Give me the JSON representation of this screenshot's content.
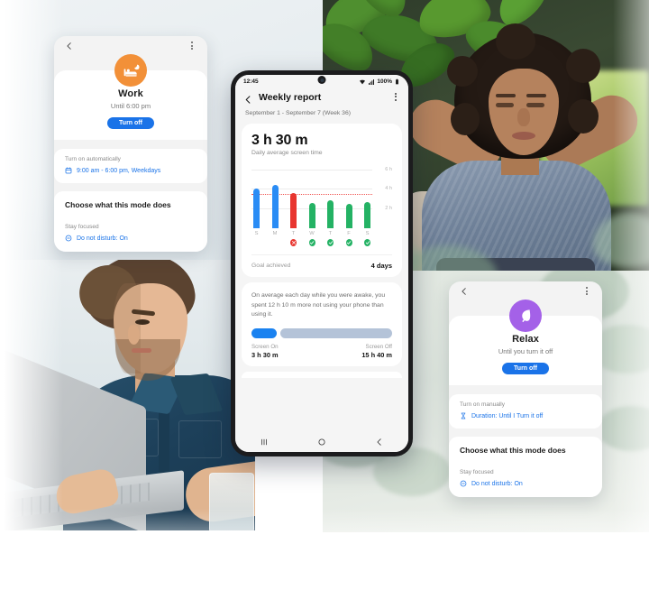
{
  "scene": {
    "photos": [
      {
        "name": "man-working-laptop",
        "alt": "Man in denim shirt working on a laptop at a desk"
      },
      {
        "name": "woman-relaxing",
        "alt": "Woman relaxing in a chair with hands behind head"
      },
      {
        "name": "eucalyptus-leaves",
        "alt": "Soft blurred eucalyptus leaves"
      }
    ]
  },
  "work_card": {
    "back_icon": "chevron-left-icon",
    "more_icon": "more-vertical-icon",
    "mode_icon": "bed-moon-icon",
    "icon_color": "#f29038",
    "title": "Work",
    "subtitle": "Until 6:00 pm",
    "button_label": "Turn off",
    "schedule_label": "Turn on automatically",
    "schedule_icon": "calendar-icon",
    "schedule_value": "9:00 am - 6:00 pm, Weekdays",
    "choose_label": "Choose what this mode does",
    "focus_label": "Stay focused",
    "focus_icon": "do-not-disturb-icon",
    "focus_value": "Do not disturb: On"
  },
  "relax_card": {
    "back_icon": "chevron-left-icon",
    "more_icon": "more-vertical-icon",
    "mode_icon": "leaf-icon",
    "icon_color": "#a461e8",
    "title": "Relax",
    "subtitle": "Until you turn it off",
    "button_label": "Turn off",
    "schedule_label": "Turn on manually",
    "schedule_icon": "hourglass-icon",
    "schedule_value": "Duration: Until I Turn it off",
    "choose_label": "Choose what this mode does",
    "focus_label": "Stay focused",
    "focus_icon": "do-not-disturb-icon",
    "focus_value": "Do not disturb: On"
  },
  "phone": {
    "status": {
      "time": "12:45",
      "wifi_icon": "wifi-icon",
      "signal_icon": "cellular-signal-icon",
      "battery_text": "100%",
      "battery_icon": "battery-full-icon"
    },
    "appbar": {
      "back_icon": "chevron-left-icon",
      "title": "Weekly report",
      "more_icon": "more-vertical-icon"
    },
    "date_range": "September 1 - September 7 (Week 36)",
    "summary": {
      "value_hours": "3 h",
      "value_minutes": "30 m",
      "caption": "Daily average screen time"
    },
    "goal_row": {
      "label": "Goal achieved",
      "value": "4 days"
    },
    "insight": {
      "text": "On average each day while you were awake, you spent 12 h 10 m more not using your phone than using it.",
      "screen_on_label": "Screen On",
      "screen_on_value": "3 h 30 m",
      "screen_off_label": "Screen Off",
      "screen_off_value": "15 h 40 m",
      "screen_on_pct": 18,
      "on_color": "#1a82f0",
      "off_color": "#b4c3d8"
    },
    "navbar": {
      "recents_icon": "recent-apps-icon",
      "home_icon": "home-circle-icon",
      "back_icon": "back-chevron-icon"
    }
  },
  "chart_data": {
    "type": "bar",
    "title": "Daily screen time",
    "categories": [
      "S",
      "M",
      "T",
      "W",
      "T",
      "F",
      "S"
    ],
    "values": [
      4.0,
      4.4,
      3.6,
      2.6,
      2.8,
      2.5,
      2.7
    ],
    "bar_colors": [
      "#2a8cf5",
      "#2a8cf5",
      "#e8352f",
      "#24b264",
      "#24b264",
      "#24b264",
      "#24b264"
    ],
    "day_status": [
      "none",
      "none",
      "fail",
      "pass",
      "pass",
      "pass",
      "pass"
    ],
    "goal_line": 3.5,
    "goal_line_color": "#ef5350",
    "ylabel": "",
    "xlabel": "",
    "ylim": [
      0,
      6.6
    ],
    "yticks": [
      2,
      4,
      6
    ],
    "ytick_labels": [
      "2 h",
      "4 h",
      "6 h"
    ],
    "grid": true,
    "legend": "none",
    "unit": "hours"
  }
}
